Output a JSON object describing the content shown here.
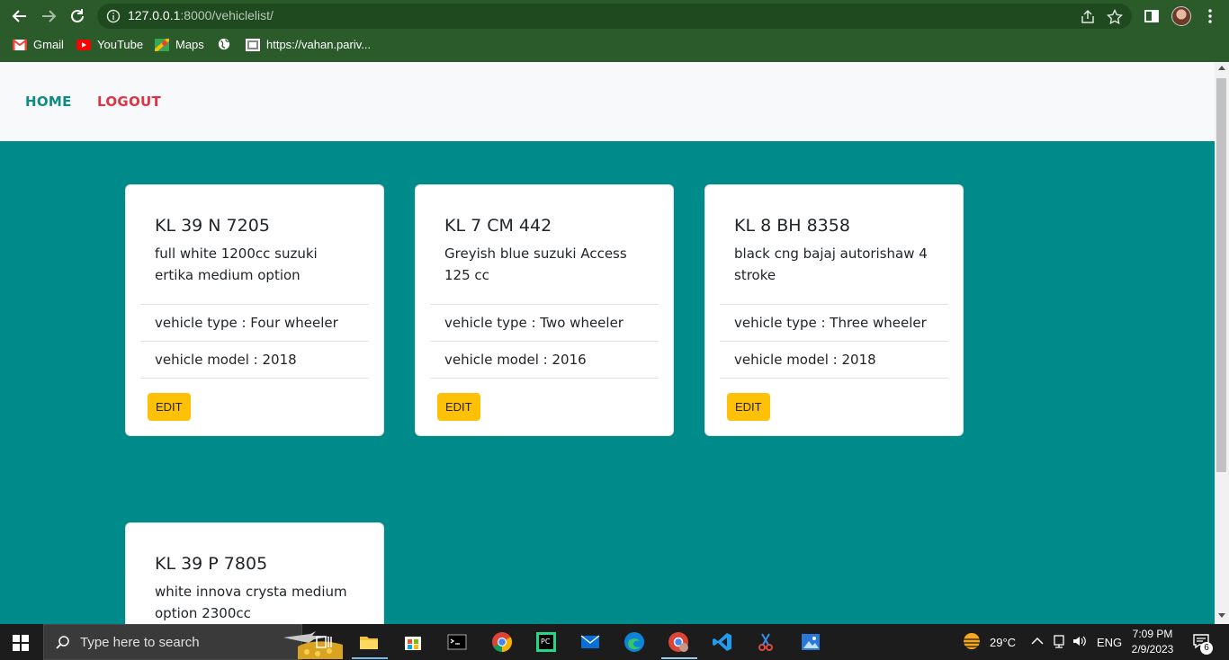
{
  "browser": {
    "url_host": "127.0.0.1",
    "url_path": ":8000/vehiclelist/",
    "bookmarks": [
      {
        "label": "Gmail",
        "icon": "gmail-icon"
      },
      {
        "label": "YouTube",
        "icon": "youtube-icon"
      },
      {
        "label": "Maps",
        "icon": "maps-icon"
      },
      {
        "label": "",
        "icon": "globe-icon"
      },
      {
        "label": "https://vahan.pariv...",
        "icon": "vahan-icon"
      }
    ]
  },
  "nav": {
    "home": "HOME",
    "logout": "LOGOUT"
  },
  "vehicles": [
    {
      "reg": "KL 39 N 7205",
      "desc": "full white 1200cc suzuki ertika medium option",
      "type": "vehicle type : Four wheeler",
      "model": "vehicle model : 2018",
      "edit": "EDIT"
    },
    {
      "reg": "KL 7 CM 442",
      "desc": "Greyish blue suzuki Access 125 cc",
      "type": "vehicle type : Two wheeler",
      "model": "vehicle model : 2016",
      "edit": "EDIT"
    },
    {
      "reg": "KL 8 BH 8358",
      "desc": "black cng bajaj autorishaw 4 stroke",
      "type": "vehicle type : Three wheeler",
      "model": "vehicle model : 2018",
      "edit": "EDIT"
    },
    {
      "reg": "KL 39 P 7805",
      "desc": "white innova crysta medium option 2300cc",
      "type": "",
      "model": "",
      "edit": ""
    }
  ],
  "taskbar": {
    "search_placeholder": "Type here to search",
    "weather": "29°C",
    "lang": "ENG",
    "time": "7:09 PM",
    "date": "2/9/2023",
    "notifications": "6"
  },
  "colors": {
    "page_bg": "#008b8b",
    "home_link": "#0f8a86",
    "logout_link": "#dc3545",
    "edit_button": "#ffc107",
    "chrome_bg": "#2b5a2b"
  }
}
